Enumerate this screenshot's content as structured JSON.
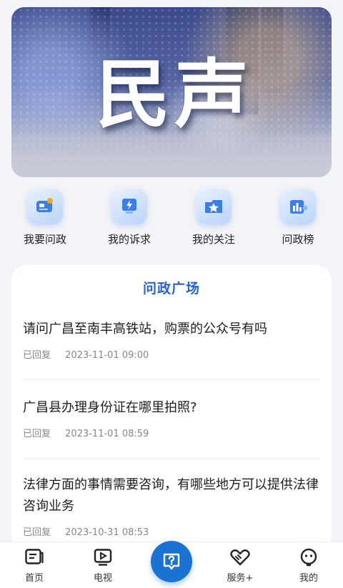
{
  "banner": {
    "title": "民声"
  },
  "quick_menu": [
    {
      "label": "我要问政",
      "icon": "camera-ask-icon"
    },
    {
      "label": "我的诉求",
      "icon": "lightning-monitor-icon"
    },
    {
      "label": "我的关注",
      "icon": "star-folder-icon"
    },
    {
      "label": "问政榜",
      "icon": "bar-chart-trophy-icon"
    }
  ],
  "section": {
    "title": "问政广场"
  },
  "posts": [
    {
      "title": "请问广昌至南丰高铁站，购票的公众号有吗",
      "status": "已回复",
      "time": "2023-11-01 09:00"
    },
    {
      "title": "广昌县办理身份证在哪里拍照?",
      "status": "已回复",
      "time": "2023-11-01 08:59"
    },
    {
      "title": "法律方面的事情需要咨询，有哪些地方可以提供法律咨询业务",
      "status": "已回复",
      "time": "2023-10-31 08:53"
    }
  ],
  "tabbar": {
    "home": "首页",
    "tv": "电视",
    "services": "服务+",
    "mine": "我的"
  },
  "colors": {
    "accent": "#1a73d2",
    "section_title": "#2a63c9"
  }
}
